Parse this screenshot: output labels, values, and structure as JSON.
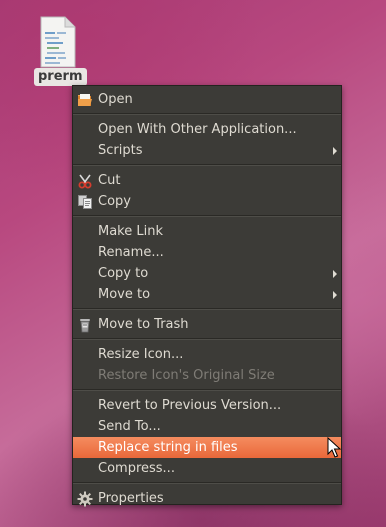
{
  "desktop": {
    "file": {
      "name": "prerm",
      "icon": "text-file-icon"
    }
  },
  "context_menu": {
    "groups": [
      [
        {
          "label": "Open",
          "icon": "folder-open-icon"
        }
      ],
      [
        {
          "label": "Open With Other Application..."
        },
        {
          "label": "Scripts",
          "submenu": true
        }
      ],
      [
        {
          "label": "Cut",
          "icon": "scissors-icon"
        },
        {
          "label": "Copy",
          "icon": "copy-icon"
        }
      ],
      [
        {
          "label": "Make Link"
        },
        {
          "label": "Rename..."
        },
        {
          "label": "Copy to",
          "submenu": true
        },
        {
          "label": "Move to",
          "submenu": true
        }
      ],
      [
        {
          "label": "Move to Trash",
          "icon": "trash-icon"
        }
      ],
      [
        {
          "label": "Resize Icon..."
        },
        {
          "label": "Restore Icon's Original Size",
          "disabled": true
        }
      ],
      [
        {
          "label": "Revert to Previous Version..."
        },
        {
          "label": "Send To..."
        },
        {
          "label": "Replace string in files",
          "highlighted": true
        },
        {
          "label": "Compress..."
        }
      ],
      [
        {
          "label": "Properties",
          "icon": "gear-icon"
        }
      ]
    ]
  },
  "colors": {
    "menu_bg": "#3c3b37",
    "menu_text": "#dfdbd2",
    "disabled_text": "#7f7c76",
    "highlight_start": "#f58c5f",
    "highlight_end": "#e9683a"
  }
}
